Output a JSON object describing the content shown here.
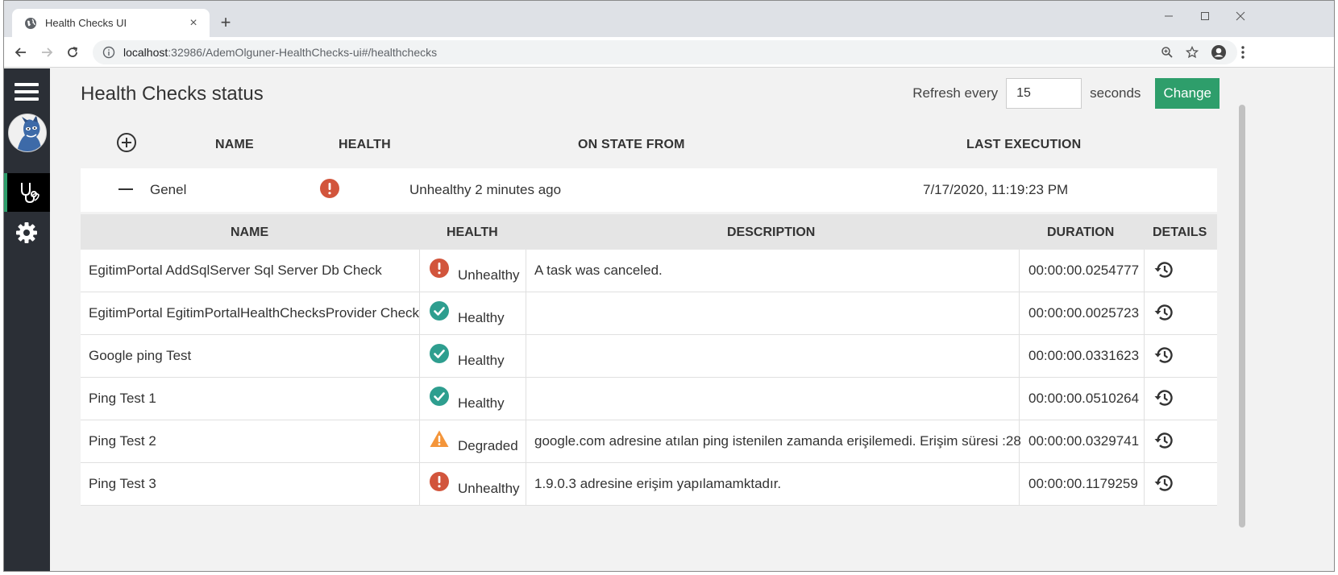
{
  "browser": {
    "tab_title": "Health Checks UI",
    "tab_close": "×",
    "new_tab": "+",
    "url_host": "localhost",
    "url_rest": ":32986/AdemOlguner-HealthChecks-ui#/healthchecks"
  },
  "page": {
    "title": "Health Checks status",
    "refresh_label": "Refresh every",
    "refresh_value": "15",
    "refresh_suffix": "seconds",
    "change_button": "Change"
  },
  "list_headers": {
    "name": "NAME",
    "health": "HEALTH",
    "on_state_from": "ON STATE FROM",
    "last_execution": "LAST EXECUTION"
  },
  "group": {
    "name": "Genel",
    "status": "unhealthy",
    "on_state_from": "Unhealthy 2 minutes ago",
    "last_execution": "7/17/2020, 11:19:23 PM"
  },
  "detail_headers": {
    "name": "NAME",
    "health": "HEALTH",
    "description": "DESCRIPTION",
    "duration": "DURATION",
    "details": "DETAILS"
  },
  "checks": [
    {
      "name": "EgitimPortal AddSqlServer Sql Server Db Check",
      "status": "unhealthy",
      "health": "Unhealthy",
      "description": "A task was canceled.",
      "duration": "00:00:00.0254777"
    },
    {
      "name": "EgitimPortal EgitimPortalHealthChecksProvider Check",
      "status": "healthy",
      "health": "Healthy",
      "description": "",
      "duration": "00:00:00.0025723"
    },
    {
      "name": "Google ping Test",
      "status": "healthy",
      "health": "Healthy",
      "description": "",
      "duration": "00:00:00.0331623"
    },
    {
      "name": "Ping Test 1",
      "status": "healthy",
      "health": "Healthy",
      "description": "",
      "duration": "00:00:00.0510264"
    },
    {
      "name": "Ping Test 2",
      "status": "degraded",
      "health": "Degraded",
      "description": "google.com adresine atılan ping istenilen zamanda erişilemedi. Erişim süresi :28",
      "duration": "00:00:00.0329741"
    },
    {
      "name": "Ping Test 3",
      "status": "unhealthy",
      "health": "Unhealthy",
      "description": "1.9.0.3 adresine erişim yapılamamktadır.",
      "duration": "00:00:00.1179259"
    }
  ],
  "colors": {
    "accent": "#2e9e6b",
    "healthy": "#2e9e8f",
    "unhealthy": "#d2553c",
    "degraded": "#f4953a",
    "sidebar": "#2b2f36"
  }
}
